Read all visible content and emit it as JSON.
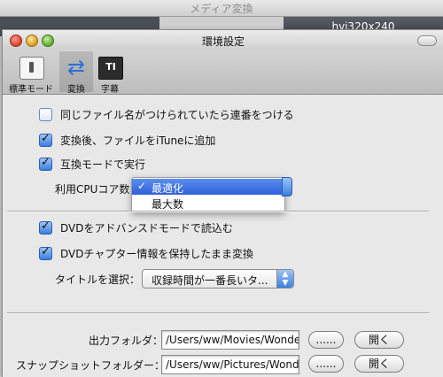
{
  "background": {
    "window_title": "メディア変換",
    "tab_label": "hvi320x240"
  },
  "window": {
    "title": "環境設定"
  },
  "toolbar": {
    "items": [
      {
        "label": "標準モード",
        "icon": "switch-icon"
      },
      {
        "label": "変換",
        "icon": "convert-arrows-icon"
      },
      {
        "label": "字幕",
        "icon": "subtitle-icon",
        "icon_text": "TI"
      }
    ],
    "selected": "変換"
  },
  "options": {
    "same_name_serial": {
      "label": "同じファイル名がつけられていたら連番をつける",
      "checked": false
    },
    "add_to_itunes": {
      "label": "変換後、ファイルをiTuneに追加",
      "checked": true
    },
    "compat_mode": {
      "label": "互換モードで実行",
      "checked": true
    },
    "cpu_cores_label": "利用CPUコア数",
    "cpu_cores_options": [
      "最適化",
      "最大数"
    ],
    "cpu_cores_selected": "最適化",
    "dvd_advanced": {
      "label": "DVDをアドバンスドモードで読込む",
      "checked": true
    },
    "dvd_chapters": {
      "label": "DVDチャプター情報を保持したまま変換",
      "checked": true
    },
    "title_select_label": "タイトルを選択：",
    "title_select_value": "収録時間が一番長いタ..."
  },
  "folders": {
    "output_label": "出力フォルダ：",
    "output_path": "/Users/ww/Movies/Wonde",
    "snapshot_label": "スナップショットフォルダー：",
    "snapshot_path": "/Users/ww/Pictures/Wond",
    "browse_label": "......",
    "open_label": "開く"
  },
  "colors": {
    "accent": "#3a7fe0",
    "selection": "#2f5fd8"
  }
}
